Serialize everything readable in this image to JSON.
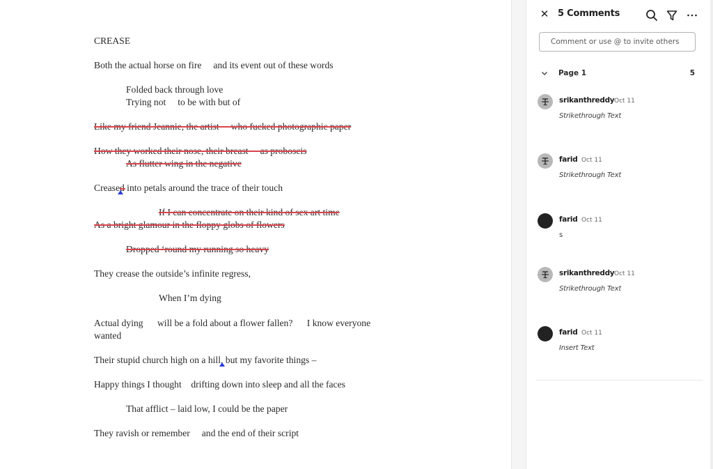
{
  "document": {
    "lines": [
      {
        "text": "CREASE",
        "struck": false
      },
      {
        "text": "Both the actual horse on fire     and its event out of these words",
        "struck": false
      },
      {
        "text": "Folded back through love",
        "struck": false
      },
      {
        "text": "Trying not     to be with but of",
        "struck": false
      },
      {
        "text": "Like my friend Jeannie, the artist     who fucked photographic paper",
        "struck": true
      },
      {
        "text": "How they worked their nose, their breast     as proboscis",
        "struck": true
      },
      {
        "text": "As flutter wing in the negative",
        "struck": true
      },
      {
        "text": "Creased into petals around the trace of their touch",
        "struck": false
      },
      {
        "text": "If I can concentrate on their kind of sex art time",
        "struck": true
      },
      {
        "text": "As a bright glamour in the floppy globs of flowers",
        "struck": true
      },
      {
        "text": "Dropped ‘round my running so heavy",
        "struck": true
      },
      {
        "text": "They crease the outside’s infinite regress,",
        "struck": false
      },
      {
        "text": "When I’m dying",
        "struck": false
      },
      {
        "text": "Actual dying      will be a fold about a flower fallen?      I know everyone",
        "struck": false
      },
      {
        "text": "wanted",
        "struck": false
      },
      {
        "text": "Their stupid church high on a hill, but my favorite things –",
        "struck": false
      },
      {
        "text": "Happy things I thought    drifting down into sleep and all the faces",
        "struck": false
      },
      {
        "text": "That afflict – laid low, I could be the paper",
        "struck": false
      },
      {
        "text": "They ravish or remember     and the end of their script",
        "struck": false
      }
    ],
    "colors": {
      "strikethrough": "#d9434a",
      "insert_caret": "#2a3bd6"
    }
  },
  "comments_panel": {
    "title": "5 Comments",
    "close_icon": "close-icon",
    "search_icon": "search-icon",
    "filter_icon": "filter-icon",
    "more_icon": "more-options-icon",
    "input_placeholder": "Comment or use @ to invite others",
    "input_value": "",
    "page_group": {
      "label": "Page 1",
      "count": "5"
    },
    "comments": [
      {
        "author": "srikanthreddy",
        "date": "Oct 11",
        "body": "Strikethrough Text",
        "avatar": "strikethrough-icon",
        "italic": true
      },
      {
        "author": "farid",
        "date": "Oct 11",
        "body": "Strikethrough Text",
        "avatar": "strikethrough-icon",
        "italic": true
      },
      {
        "author": "farid",
        "date": "Oct 11",
        "body": "s",
        "avatar": "dark-avatar",
        "italic": false
      },
      {
        "author": "srikanthreddy",
        "date": "Oct 11",
        "body": "Strikethrough Text",
        "avatar": "strikethrough-icon",
        "italic": true
      },
      {
        "author": "farid",
        "date": "Oct 11",
        "body": "Insert Text",
        "avatar": "dark-avatar",
        "italic": true
      }
    ]
  }
}
